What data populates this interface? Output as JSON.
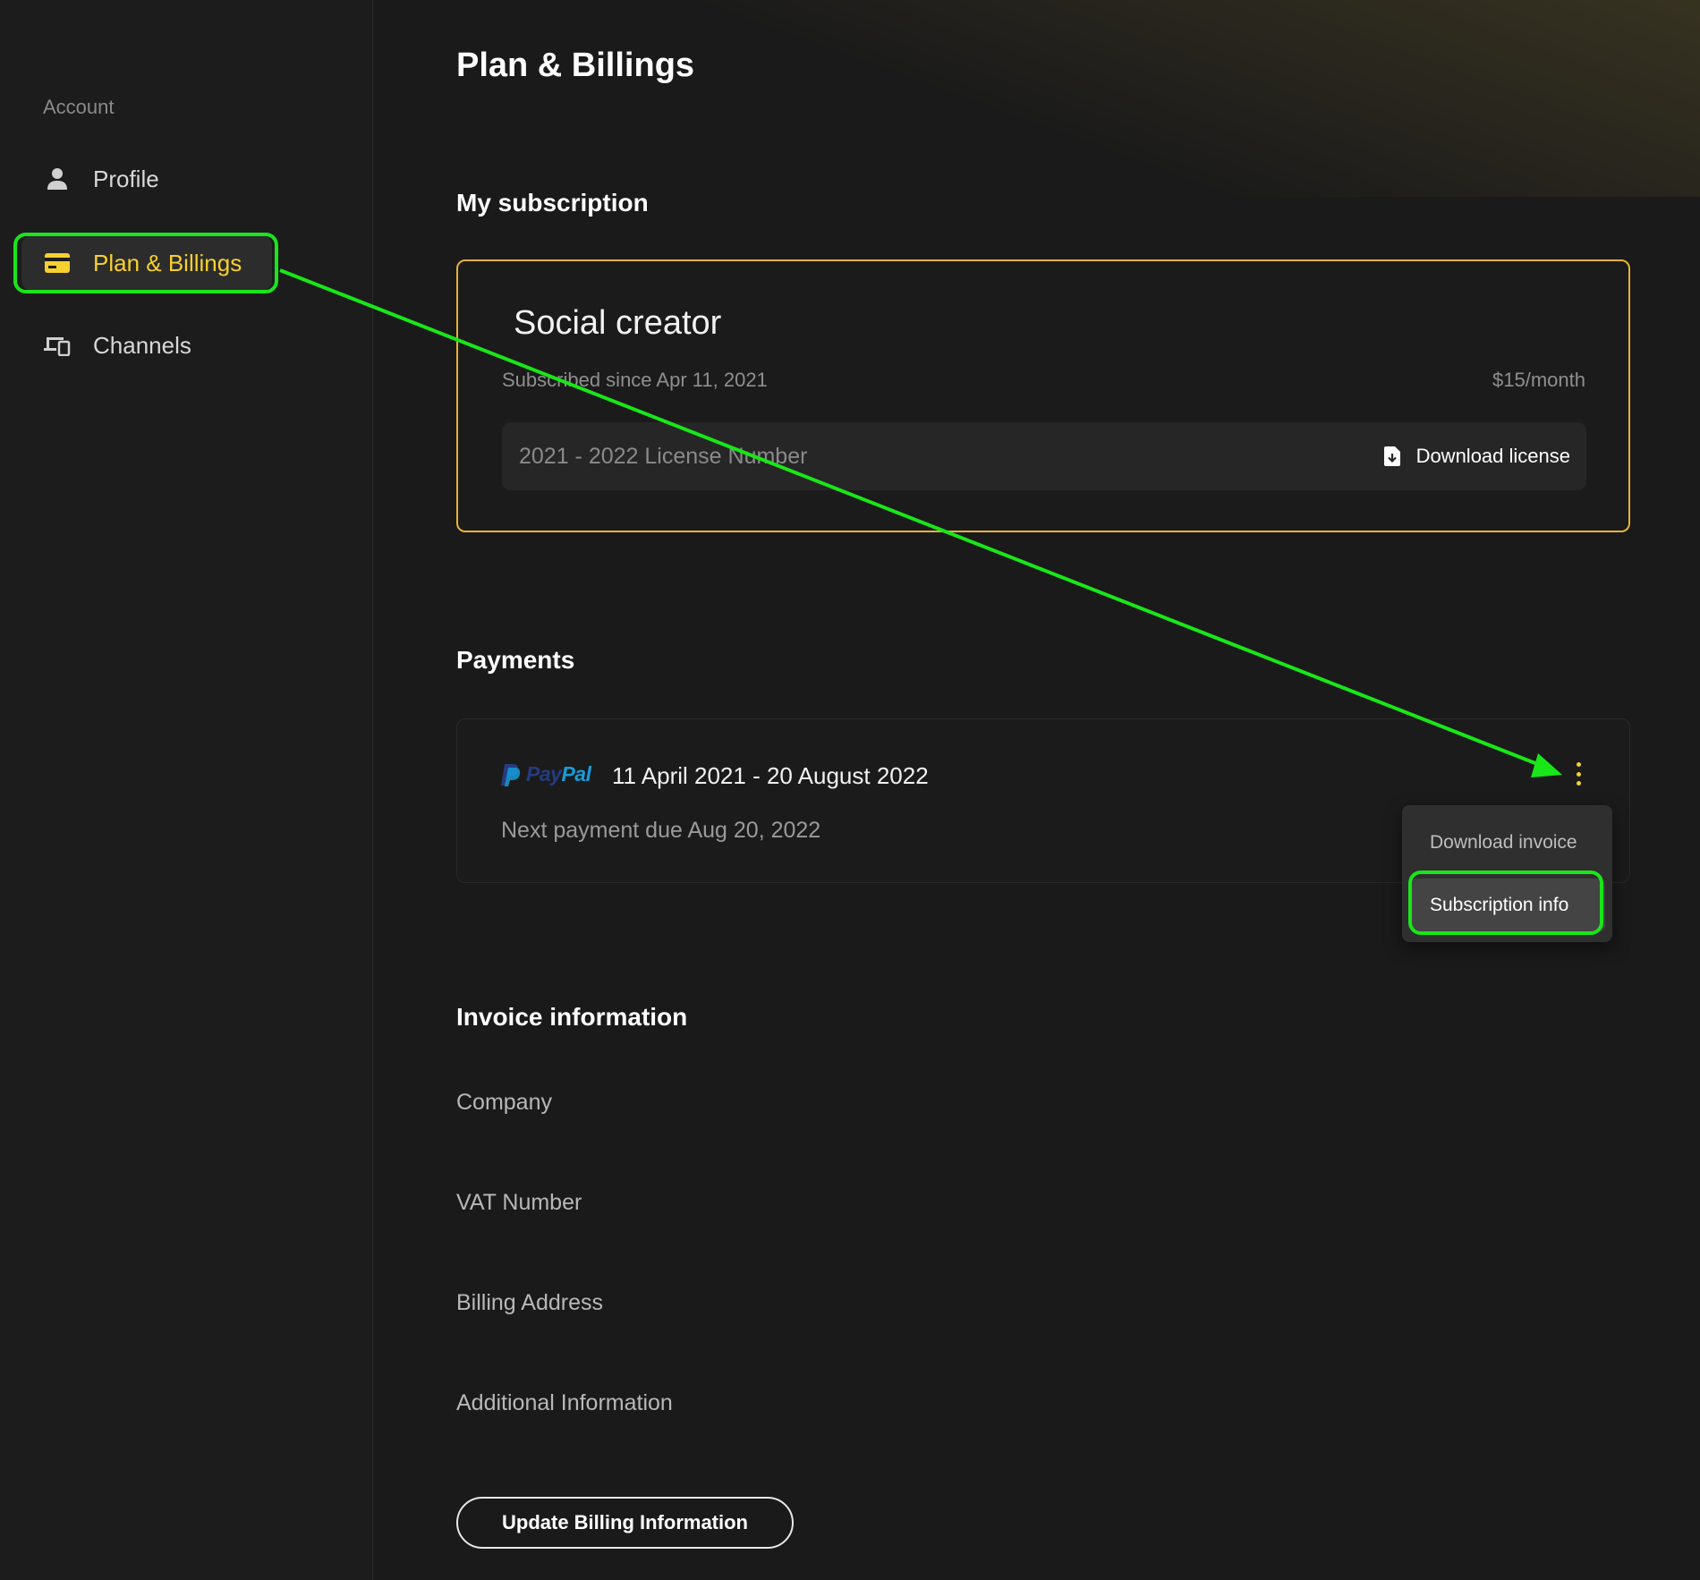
{
  "sidebar": {
    "section_label": "Account",
    "items": [
      {
        "label": "Profile",
        "icon": "person-icon"
      },
      {
        "label": "Plan & Billings",
        "icon": "credit-card-icon",
        "active": true
      },
      {
        "label": "Channels",
        "icon": "devices-icon"
      }
    ]
  },
  "main": {
    "title": "Plan & Billings",
    "subscription": {
      "heading": "My subscription",
      "plan_name": "Social creator",
      "since": "Subscribed since Apr 11, 2021",
      "price": "$15/month",
      "license_placeholder": "2021 - 2022 License Number",
      "download_license_label": "Download license"
    },
    "payments": {
      "heading": "Payments",
      "provider": {
        "part1": "Pay",
        "part2": "Pal"
      },
      "range": "11 April 2021 - 20 August 2022",
      "next_due": "Next payment due Aug 20, 2022",
      "menu": {
        "items": [
          {
            "label": "Download invoice"
          },
          {
            "label": "Subscription info",
            "selected": true
          }
        ]
      }
    },
    "invoice": {
      "heading": "Invoice information",
      "fields": [
        "Company",
        "VAT Number",
        "Billing Address",
        "Additional Information"
      ],
      "update_button": "Update Billing Information"
    }
  },
  "colors": {
    "background": "#1a1a1a",
    "accent": "#f6d02f",
    "card_border": "#e7b23a",
    "annotation": "#19e619"
  }
}
